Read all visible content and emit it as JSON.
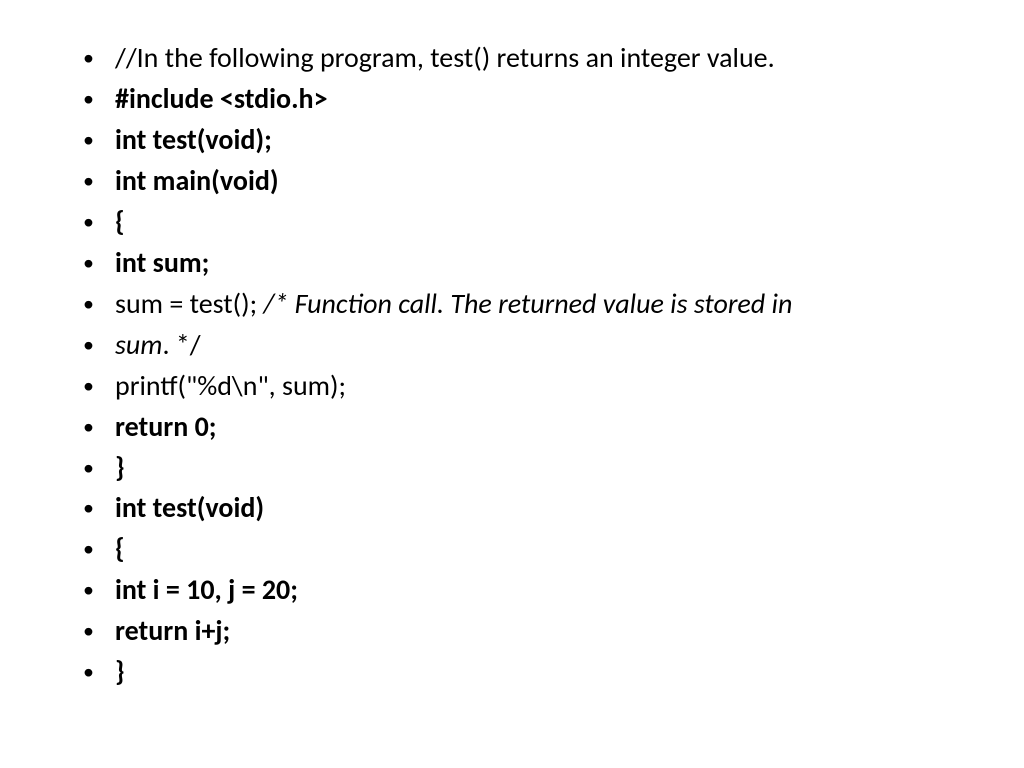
{
  "lines": {
    "l0": "//In the following program, test() returns an integer value.",
    "l1": "#include <stdio.h>",
    "l2": "int test(void);",
    "l3": "int main(void)",
    "l4": "{",
    "l5": "int sum;",
    "l6a": "sum = test(); ",
    "l6b": "/* Function call. The returned value is stored in",
    "l7a": "sum",
    "l7b": ". */",
    "l8": "printf(\"%d\\n\", sum);",
    "l9": "return 0;",
    "l10": "}",
    "l11": "int test(void)",
    "l12": "{",
    "l13": "int i = 10, j = 20;",
    "l14": "return i+j;",
    "l15": "}"
  }
}
